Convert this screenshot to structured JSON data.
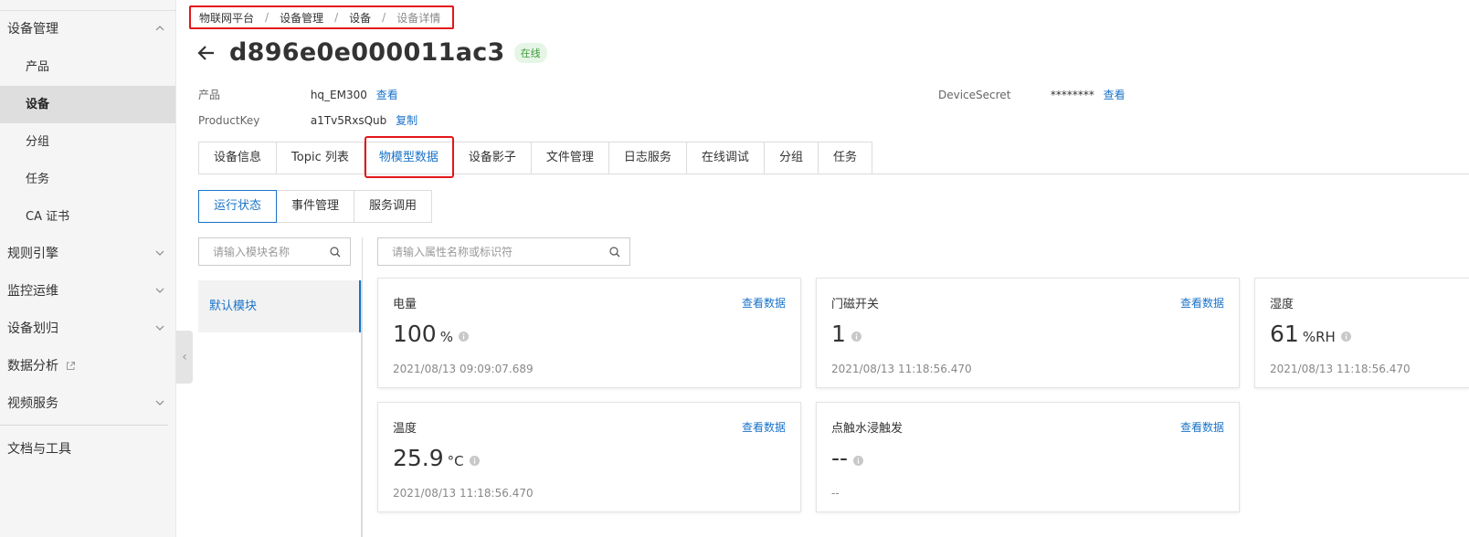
{
  "sidebar": {
    "groups": [
      {
        "label": "设备管理",
        "items": [
          "产品",
          "设备",
          "分组",
          "任务",
          "CA 证书"
        ],
        "active": "设备"
      },
      {
        "label": "规则引擎"
      },
      {
        "label": "监控运维"
      },
      {
        "label": "设备划归"
      },
      {
        "label": "数据分析"
      },
      {
        "label": "视频服务"
      }
    ],
    "footer": "文档与工具"
  },
  "breadcrumb": [
    "物联网平台",
    "设备管理",
    "设备",
    "设备详情"
  ],
  "device": {
    "name": "d896e0e000011ac3",
    "status": "在线",
    "product_label": "产品",
    "product_value": "hq_EM300",
    "product_link": "查看",
    "productkey_label": "ProductKey",
    "productkey_value": "a1Tv5RxsQub",
    "productkey_link": "复制",
    "secret_label": "DeviceSecret",
    "secret_value": "********",
    "secret_link": "查看"
  },
  "tabs": [
    "设备信息",
    "Topic 列表",
    "物模型数据",
    "设备影子",
    "文件管理",
    "日志服务",
    "在线调试",
    "分组",
    "任务"
  ],
  "active_tab": "物模型数据",
  "subtabs": [
    "运行状态",
    "事件管理",
    "服务调用"
  ],
  "active_subtab": "运行状态",
  "module_search": {
    "placeholder": "请输入模块名称"
  },
  "property_search": {
    "placeholder": "请输入属性名称或标识符"
  },
  "modules": [
    "默认模块"
  ],
  "view_label": "查看数据",
  "properties": [
    {
      "name": "电量",
      "value": "100",
      "unit": "%",
      "time": "2021/08/13 09:09:07.689"
    },
    {
      "name": "门磁开关",
      "value": "1",
      "unit": "",
      "time": "2021/08/13 11:18:56.470"
    },
    {
      "name": "湿度",
      "value": "61",
      "unit": "%RH",
      "time": "2021/08/13 11:18:56.470"
    },
    {
      "name": "温度",
      "value": "25.9",
      "unit": "°C",
      "time": "2021/08/13 11:18:56.470"
    },
    {
      "name": "点触水浸触发",
      "value": "--",
      "unit": "",
      "time": "--"
    }
  ],
  "colors": {
    "accent": "#1a73c9",
    "highlight": "#e3161b",
    "online": "#3c9a3c"
  }
}
